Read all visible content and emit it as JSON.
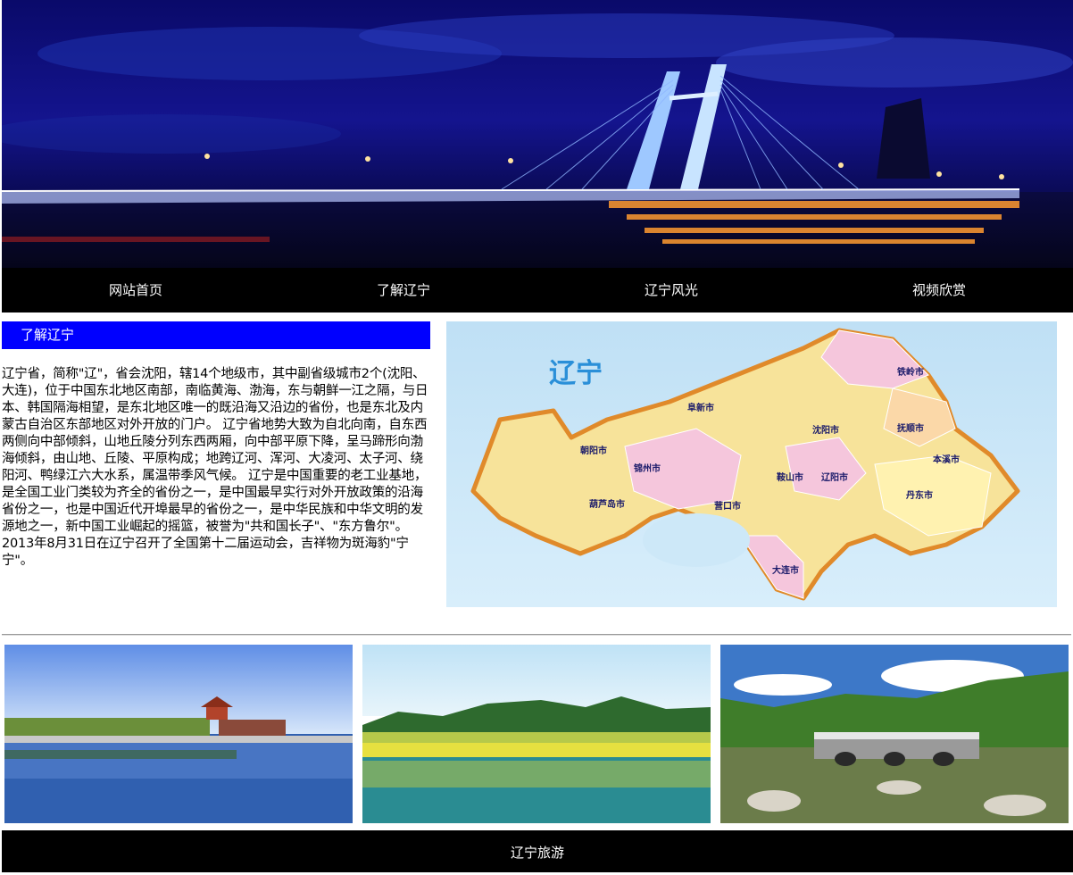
{
  "nav": {
    "items": [
      {
        "label": "网站首页"
      },
      {
        "label": "了解辽宁"
      },
      {
        "label": "辽宁风光"
      },
      {
        "label": "视频欣赏"
      }
    ]
  },
  "section": {
    "title": "了解辽宁",
    "body": "辽宁省，简称\"辽\"，省会沈阳，辖14个地级市，其中副省级城市2个(沈阳、大连)，位于中国东北地区南部，南临黄海、渤海，东与朝鲜一江之隔，与日本、韩国隔海相望，是东北地区唯一的既沿海又沿边的省份，也是东北及内蒙古自治区东部地区对外开放的门户。 辽宁省地势大致为自北向南，自东西两侧向中部倾斜，山地丘陵分列东西两厢，向中部平原下降，呈马蹄形向渤海倾斜，由山地、丘陵、平原构成；地跨辽河、浑河、大凌河、太子河、绕阳河、鸭绿江六大水系，属温带季风气候。 辽宁是中国重要的老工业基地，是全国工业门类较为齐全的省份之一，是中国最早实行对外开放政策的沿海省份之一，也是中国近代开埠最早的省份之一，是中华民族和中华文明的发源地之一，新中国工业崛起的摇篮，被誉为\"共和国长子\"、\"东方鲁尔\"。2013年8月31日在辽宁召开了全国第十二届运动会，吉祥物为斑海豹\"宁宁\"。"
  },
  "map": {
    "title": "辽宁",
    "cities": [
      "铁岭市",
      "阜新市",
      "沈阳市",
      "抚顺市",
      "朝阳市",
      "锦州市",
      "辽阳市",
      "本溪市",
      "葫芦岛市",
      "营口市",
      "丹东市",
      "鞍山市",
      "大连市"
    ]
  },
  "footer": {
    "text": "辽宁旅游"
  },
  "colors": {
    "nav_bg": "#000000",
    "header_bg": "#0000ff",
    "text": "#000000"
  }
}
